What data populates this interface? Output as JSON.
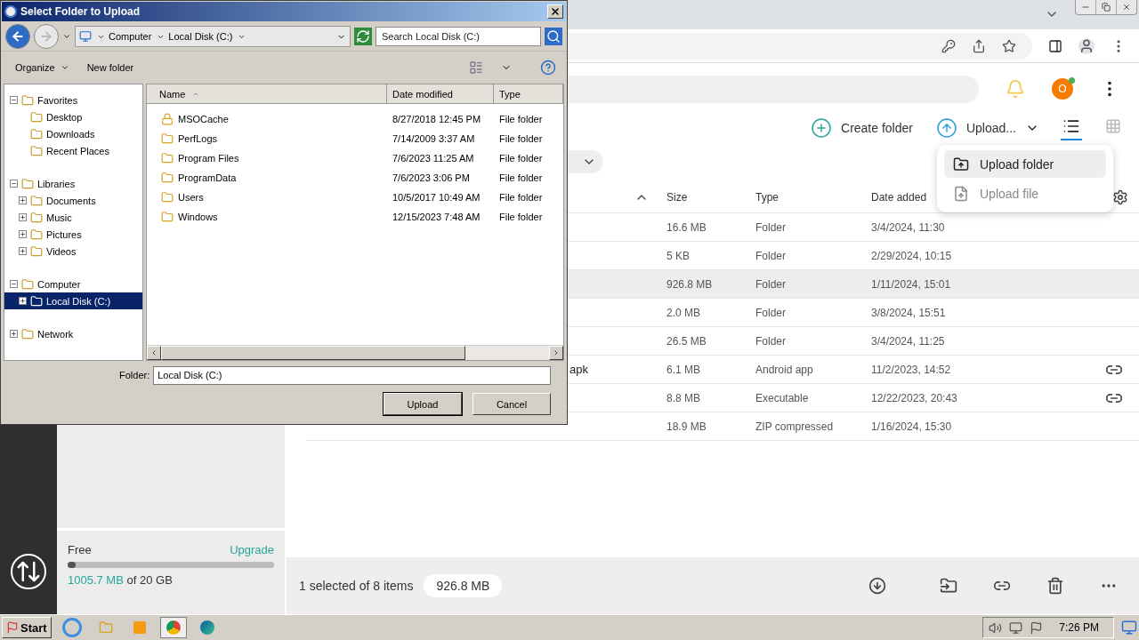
{
  "browser": {
    "app": {
      "toolbar": {
        "create_folder": "Create folder",
        "upload": "Upload..."
      },
      "avatar": "O",
      "upload_menu": [
        {
          "label": "Upload folder",
          "selected": true
        },
        {
          "label": "Upload file",
          "selected": false
        }
      ],
      "table": {
        "columns": [
          "Size",
          "Type",
          "Date added"
        ],
        "rows": [
          {
            "size": "16.6 MB",
            "type": "Folder",
            "date": "3/4/2024, 11:30",
            "selected": false,
            "linked": false
          },
          {
            "size": "5 KB",
            "type": "Folder",
            "date": "2/29/2024, 10:15",
            "selected": false,
            "linked": false
          },
          {
            "size": "926.8 MB",
            "type": "Folder",
            "date": "1/11/2024, 15:01",
            "selected": true,
            "linked": false
          },
          {
            "size": "2.0 MB",
            "type": "Folder",
            "date": "3/8/2024, 15:51",
            "selected": false,
            "linked": false
          },
          {
            "size": "26.5 MB",
            "type": "Folder",
            "date": "3/4/2024, 11:25",
            "selected": false,
            "linked": false
          },
          {
            "name": "apk",
            "size": "6.1 MB",
            "type": "Android app",
            "date": "11/2/2023, 14:52",
            "selected": false,
            "linked": true
          },
          {
            "size": "8.8 MB",
            "type": "Executable",
            "date": "12/22/2023, 20:43",
            "selected": false,
            "linked": true
          },
          {
            "size": "18.9 MB",
            "type": "ZIP compressed",
            "date": "1/16/2024, 15:30",
            "selected": false,
            "linked": false
          }
        ]
      },
      "storage": {
        "plan": "Free",
        "upgrade": "Upgrade",
        "level": 0.04,
        "used": "1005.7 MB",
        "total": "of 20 GB"
      },
      "status": {
        "selection": "1 selected of 8 items",
        "size": "926.8 MB"
      }
    }
  },
  "dialog": {
    "title": "Select Folder to Upload",
    "breadcrumbs": [
      "Computer",
      "Local Disk (C:)"
    ],
    "search": {
      "placeholder": "Search Local Disk (C:)"
    },
    "commands": [
      "Organize",
      "New folder"
    ],
    "tree": [
      {
        "label": "Favorites",
        "expanded": true,
        "selected": false,
        "children": [
          {
            "label": "Desktop",
            "selected": false
          },
          {
            "label": "Downloads",
            "selected": false
          },
          {
            "label": "Recent Places",
            "selected": false
          }
        ]
      },
      {
        "label": "Libraries",
        "expanded": true,
        "selected": false,
        "children": [
          {
            "label": "Documents",
            "expanded": false,
            "selected": false
          },
          {
            "label": "Music",
            "expanded": false,
            "selected": false
          },
          {
            "label": "Pictures",
            "expanded": false,
            "selected": false
          },
          {
            "label": "Videos",
            "expanded": false,
            "selected": false
          }
        ]
      },
      {
        "label": "Computer",
        "expanded": true,
        "selected": false,
        "children": [
          {
            "label": "Local Disk (C:)",
            "expanded": false,
            "selected": true
          }
        ]
      },
      {
        "label": "Network",
        "expanded": false,
        "selected": false
      }
    ],
    "columns": [
      "Name",
      "Date modified",
      "Type"
    ],
    "files": [
      {
        "name": "MSOCache",
        "date": "8/27/2018 12:45 PM",
        "type": "File folder",
        "locked": true
      },
      {
        "name": "PerfLogs",
        "date": "7/14/2009 3:37 AM",
        "type": "File folder",
        "locked": false
      },
      {
        "name": "Program Files",
        "date": "7/6/2023 11:25 AM",
        "type": "File folder",
        "locked": false
      },
      {
        "name": "ProgramData",
        "date": "7/6/2023 3:06 PM",
        "type": "File folder",
        "locked": false
      },
      {
        "name": "Users",
        "date": "10/5/2017 10:49 AM",
        "type": "File folder",
        "locked": false
      },
      {
        "name": "Windows",
        "date": "12/15/2023 7:48 AM",
        "type": "File folder",
        "locked": false
      }
    ],
    "folder_label": "Folder:",
    "folder_value": "Local Disk (C:)",
    "buttons": [
      "Upload",
      "Cancel"
    ]
  },
  "taskbar": {
    "start": "Start",
    "clock": "7:26 PM"
  }
}
